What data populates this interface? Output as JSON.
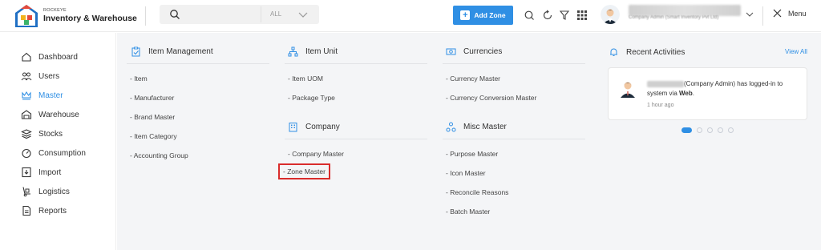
{
  "header": {
    "brand_small": "ROCKEYE",
    "brand_name": "Inventory & Warehouse",
    "search_placeholder": "",
    "search_filter": "ALL",
    "add_zone_label": "Add Zone",
    "user_subtitle": "Company Admin (Smart Inventory Pvt Ltd)",
    "menu_label": "Menu",
    "accent": "#2f8fe4"
  },
  "sidebar": {
    "items": [
      {
        "label": "Dashboard",
        "icon": "home-icon"
      },
      {
        "label": "Users",
        "icon": "users-icon"
      },
      {
        "label": "Master",
        "icon": "crown-icon",
        "active": true
      },
      {
        "label": "Warehouse",
        "icon": "warehouse-icon"
      },
      {
        "label": "Stocks",
        "icon": "stack-icon"
      },
      {
        "label": "Consumption",
        "icon": "gauge-icon"
      },
      {
        "label": "Import",
        "icon": "import-icon"
      },
      {
        "label": "Logistics",
        "icon": "hand-truck-icon"
      },
      {
        "label": "Reports",
        "icon": "report-icon"
      }
    ]
  },
  "sections": {
    "item_management": {
      "title": "Item Management",
      "links": [
        "- Item",
        "- Manufacturer",
        "- Brand Master",
        "- Item Category",
        "- Accounting Group"
      ]
    },
    "item_unit": {
      "title": "Item Unit",
      "links": [
        "- Item UOM",
        "- Package Type"
      ]
    },
    "company": {
      "title": "Company",
      "links": [
        "- Company Master",
        "- Zone Master"
      ]
    },
    "currencies": {
      "title": "Currencies",
      "links": [
        "- Currency Master",
        "- Currency Conversion Master"
      ]
    },
    "misc_master": {
      "title": "Misc Master",
      "links": [
        "- Purpose Master",
        "- Icon Master",
        "- Reconcile Reasons",
        "- Batch Master"
      ]
    }
  },
  "activities": {
    "title": "Recent Activities",
    "view_all": "View All",
    "role": "(Company Admin)",
    "message_mid": " has logged-in to system via ",
    "via": "Web",
    "message_end": ".",
    "time": "1 hour ago",
    "dots": 5,
    "active_dot": 0
  }
}
